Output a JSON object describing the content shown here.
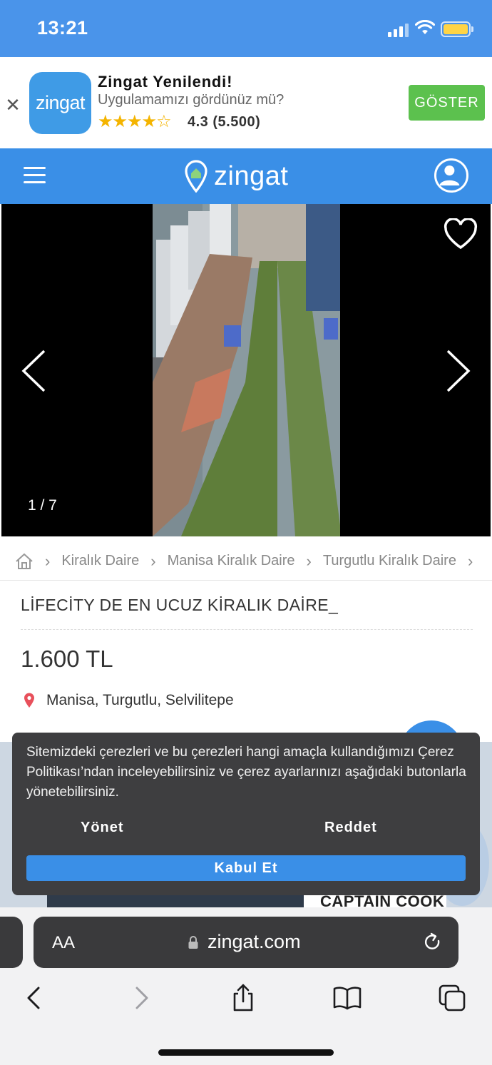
{
  "status_bar": {
    "time": "13:21"
  },
  "app_banner": {
    "close_label": "✕",
    "app_icon_text": "zingat",
    "title": "Zingat Yenilendi!",
    "subtitle": "Uygulamamızı gördünüz mü?",
    "stars": "★★★★☆",
    "rating": "4.3 (5.500)",
    "button_label": "GÖSTER"
  },
  "header": {
    "logo_text": "zingat",
    "menu_icon": "hamburger-menu-icon",
    "user_icon": "user-avatar-icon"
  },
  "gallery": {
    "counter": "1 / 7",
    "favorite_icon": "heart-icon",
    "prev_icon": "chevron-left-icon",
    "next_icon": "chevron-right-icon"
  },
  "breadcrumb": {
    "home_icon": "home-icon",
    "separator": "›",
    "items": [
      "Kiralık Daire",
      "Manisa Kiralık Daire",
      "Turgutlu Kiralık Daire"
    ]
  },
  "listing": {
    "title": "LİFECİTY DE EN UCUZ KİRALIK DAİRE_",
    "price": "1.600 TL",
    "location": "Manisa, Turgutlu, Selvilitepe"
  },
  "ad": {
    "text": "CAPTAIN COOK"
  },
  "cookie_notice": {
    "text": "Sitemizdeki çerezleri ve bu çerezleri hangi amaçla kullandığımızı Çerez Politikası’ndan inceleyebilirsiniz ve çerez ayarlarınızı aşağıdaki butonlarla yönetebilirsiniz.",
    "manage_label": "Yönet",
    "reject_label": "Reddet",
    "accept_label": "Kabul Et"
  },
  "browser": {
    "text_size_label": "AA",
    "url": "zingat.com",
    "toolbar_icons": [
      "back-icon",
      "forward-icon",
      "share-icon",
      "bookmarks-icon",
      "tabs-icon"
    ]
  },
  "colors": {
    "primary": "#3a8fe7",
    "banner_button": "#5cc14e",
    "star": "#f4b400",
    "location_pin": "#e8505b"
  }
}
